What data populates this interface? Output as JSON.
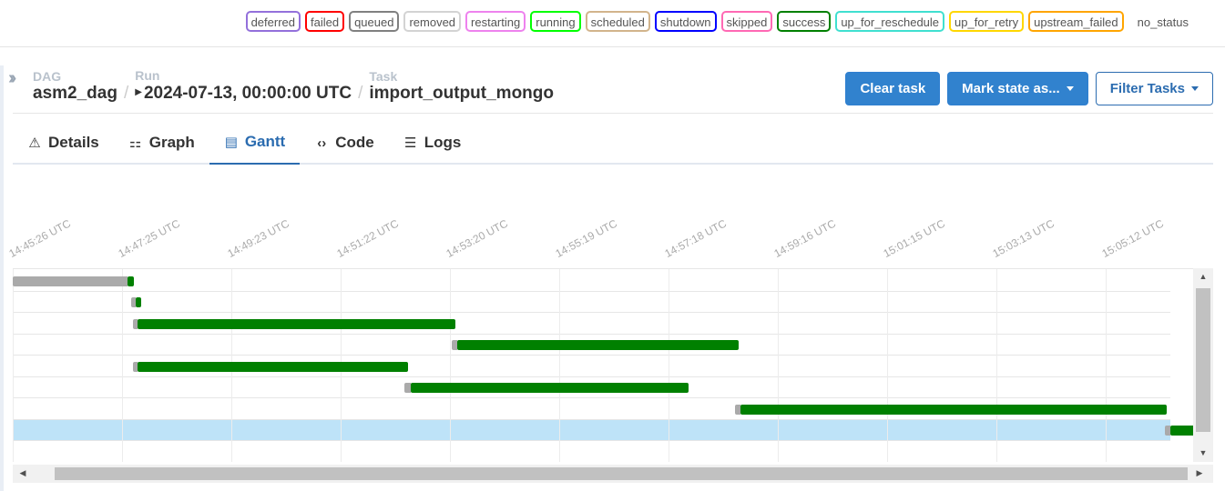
{
  "legend": [
    {
      "label": "deferred",
      "color": "#9370db"
    },
    {
      "label": "failed",
      "color": "#ff0000"
    },
    {
      "label": "queued",
      "color": "#808080"
    },
    {
      "label": "removed",
      "color": "#d3d3d3"
    },
    {
      "label": "restarting",
      "color": "#ee82ee"
    },
    {
      "label": "running",
      "color": "#00ff00"
    },
    {
      "label": "scheduled",
      "color": "#d2b48c"
    },
    {
      "label": "shutdown",
      "color": "#0000ff"
    },
    {
      "label": "skipped",
      "color": "#ff69b4"
    },
    {
      "label": "success",
      "color": "#008000"
    },
    {
      "label": "up_for_reschedule",
      "color": "#40e0d0"
    },
    {
      "label": "up_for_retry",
      "color": "#ffd700"
    },
    {
      "label": "upstream_failed",
      "color": "#ffa500"
    },
    {
      "label": "no_status",
      "color": null
    }
  ],
  "breadcrumb": {
    "dag_label": "DAG",
    "dag_value": "asm2_dag",
    "run_label": "Run",
    "run_value": "2024-07-13, 00:00:00 UTC",
    "task_label": "Task",
    "task_value": "import_output_mongo",
    "separator": "/"
  },
  "actions": {
    "clear": "Clear task",
    "mark": "Mark state as...",
    "filter": "Filter Tasks"
  },
  "tabs": [
    {
      "label": "Details",
      "icon": "warning-icon",
      "glyph": "⚠",
      "active": false
    },
    {
      "label": "Graph",
      "icon": "graph-icon",
      "glyph": "⚏",
      "active": false
    },
    {
      "label": "Gantt",
      "icon": "gantt-icon",
      "glyph": "▤",
      "active": true
    },
    {
      "label": "Code",
      "icon": "code-icon",
      "glyph": "‹›",
      "active": false
    },
    {
      "label": "Logs",
      "icon": "logs-icon",
      "glyph": "☰",
      "active": false
    }
  ],
  "gantt": {
    "ticks": [
      "14:45:26 UTC",
      "14:47:25 UTC",
      "14:49:23 UTC",
      "14:51:22 UTC",
      "14:53:20 UTC",
      "14:55:19 UTC",
      "14:57:18 UTC",
      "14:59:16 UTC",
      "15:01:15 UTC",
      "15:03:13 UTC",
      "15:05:12 UTC"
    ],
    "tick_seconds": [
      0,
      119,
      237,
      356,
      474,
      593,
      712,
      830,
      949,
      1067,
      1186
    ],
    "selected_row": 7,
    "tasks": [
      {
        "queued_start": 0,
        "start": 125,
        "end": 131,
        "state": "success"
      },
      {
        "queued_start": 128,
        "start": 133,
        "end": 139,
        "state": "success"
      },
      {
        "queued_start": 130,
        "start": 135,
        "end": 480,
        "state": "success"
      },
      {
        "queued_start": 476,
        "start": 482,
        "end": 788,
        "state": "success"
      },
      {
        "queued_start": 130,
        "start": 135,
        "end": 429,
        "state": "success"
      },
      {
        "queued_start": 425,
        "start": 432,
        "end": 733,
        "state": "success"
      },
      {
        "queued_start": 784,
        "start": 790,
        "end": 1252,
        "state": "success"
      },
      {
        "queued_start": 1250,
        "start": 1256,
        "end": 1285,
        "state": "success"
      }
    ]
  }
}
